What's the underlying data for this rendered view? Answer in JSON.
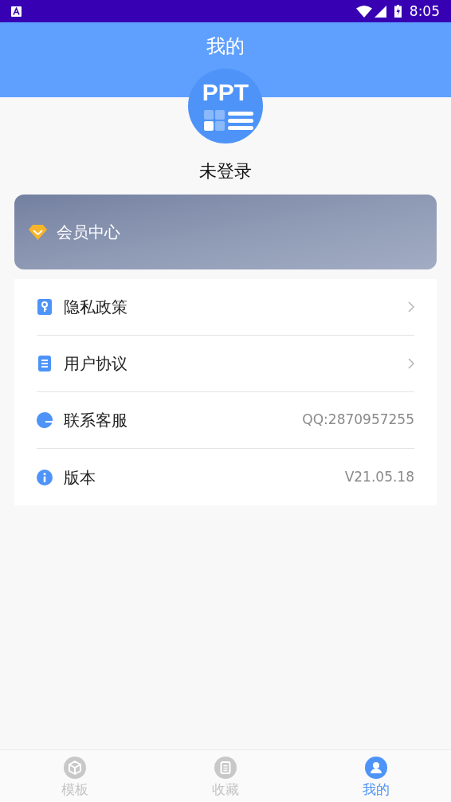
{
  "status_bar": {
    "time": "8:05"
  },
  "header": {
    "title": "我的"
  },
  "profile": {
    "logo_text": "PPT",
    "name": "未登录"
  },
  "vip_card": {
    "label": "会员中心"
  },
  "menu": [
    {
      "kind": "privacy",
      "label": "隐私政策",
      "chevron": true
    },
    {
      "kind": "agreement",
      "label": "用户协议",
      "chevron": true
    },
    {
      "kind": "service",
      "label": "联系客服",
      "value": "QQ:2870957255",
      "chevron": false
    },
    {
      "kind": "version",
      "label": "版本",
      "value": "V21.05.18",
      "chevron": false
    }
  ],
  "tabs": [
    {
      "kind": "template",
      "label": "模板",
      "selected": false
    },
    {
      "kind": "favorite",
      "label": "收藏",
      "selected": false
    },
    {
      "kind": "mine",
      "label": "我的",
      "selected": true
    }
  ]
}
